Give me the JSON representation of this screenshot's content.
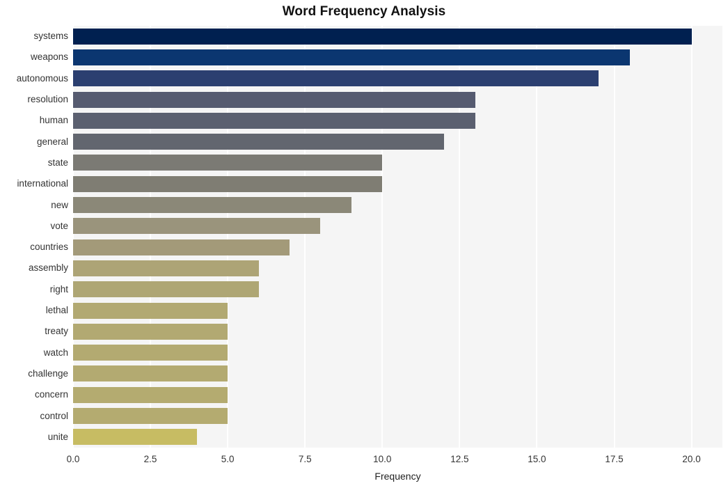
{
  "chart_data": {
    "type": "bar",
    "orientation": "horizontal",
    "title": "Word Frequency Analysis",
    "xlabel": "Frequency",
    "ylabel": "",
    "xlim": [
      0,
      21.0
    ],
    "ylim": [
      0,
      20
    ],
    "grid": true,
    "legend": null,
    "background": "#f5f5f5",
    "gridline_color": "#ffffff",
    "xticks": [
      "0.0",
      "2.5",
      "5.0",
      "7.5",
      "10.0",
      "12.5",
      "15.0",
      "17.5",
      "20.0"
    ],
    "xtick_values": [
      0,
      2.5,
      5,
      7.5,
      10,
      12.5,
      15,
      17.5,
      20
    ],
    "categories": [
      "systems",
      "weapons",
      "autonomous",
      "resolution",
      "human",
      "general",
      "state",
      "international",
      "new",
      "vote",
      "countries",
      "assembly",
      "right",
      "lethal",
      "treaty",
      "watch",
      "challenge",
      "concern",
      "control",
      "unite"
    ],
    "values": [
      20,
      18,
      17,
      13,
      13,
      12,
      10,
      10,
      9,
      8,
      7,
      6,
      6,
      5,
      5,
      5,
      5,
      5,
      5,
      4
    ],
    "bar_colors": [
      "#002050",
      "#0b3670",
      "#2b3f70",
      "#565b70",
      "#5b6070",
      "#62666f",
      "#7b7a74",
      "#7f7d73",
      "#8b8878",
      "#9a947c",
      "#a39a79",
      "#ada476",
      "#aea674",
      "#b2a972",
      "#b2a972",
      "#b3aa71",
      "#b3aa71",
      "#b4ab70",
      "#b4ab70",
      "#c7bc63"
    ],
    "bars": [
      {
        "label": "systems",
        "value": 20,
        "color": "#002050"
      },
      {
        "label": "weapons",
        "value": 18,
        "color": "#0b3670"
      },
      {
        "label": "autonomous",
        "value": 17,
        "color": "#2b3f70"
      },
      {
        "label": "resolution",
        "value": 13,
        "color": "#565b70"
      },
      {
        "label": "human",
        "value": 13,
        "color": "#5b6070"
      },
      {
        "label": "general",
        "value": 12,
        "color": "#62666f"
      },
      {
        "label": "state",
        "value": 10,
        "color": "#7b7a74"
      },
      {
        "label": "international",
        "value": 10,
        "color": "#7f7d73"
      },
      {
        "label": "new",
        "value": 9,
        "color": "#8b8878"
      },
      {
        "label": "vote",
        "value": 8,
        "color": "#9a947c"
      },
      {
        "label": "countries",
        "value": 7,
        "color": "#a39a79"
      },
      {
        "label": "assembly",
        "value": 6,
        "color": "#ada476"
      },
      {
        "label": "right",
        "value": 6,
        "color": "#aea674"
      },
      {
        "label": "lethal",
        "value": 5,
        "color": "#b2a972"
      },
      {
        "label": "treaty",
        "value": 5,
        "color": "#b2a972"
      },
      {
        "label": "watch",
        "value": 5,
        "color": "#b3aa71"
      },
      {
        "label": "challenge",
        "value": 5,
        "color": "#b3aa71"
      },
      {
        "label": "concern",
        "value": 5,
        "color": "#b4ab70"
      },
      {
        "label": "control",
        "value": 5,
        "color": "#b4ab70"
      },
      {
        "label": "unite",
        "value": 4,
        "color": "#c7bc63"
      }
    ]
  }
}
